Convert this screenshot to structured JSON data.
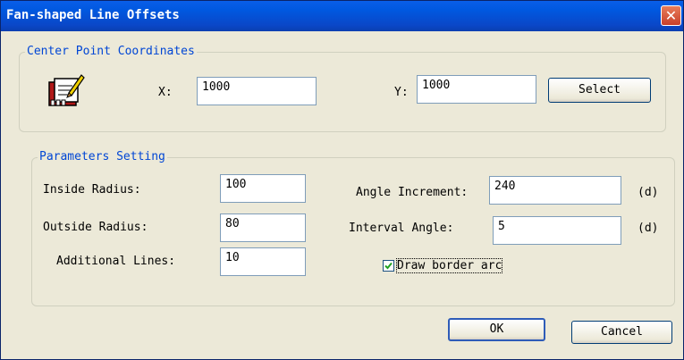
{
  "window": {
    "title": "Fan-shaped Line Offsets"
  },
  "center": {
    "legend": "Center Point Coordinates",
    "x_label": "X:",
    "x_value": "1000",
    "y_label": "Y:",
    "y_value": "1000",
    "select_label": "Select"
  },
  "params": {
    "legend": "Parameters Setting",
    "inside_radius_label": "Inside Radius:",
    "inside_radius_value": "100",
    "outside_radius_label": "Outside Radius:",
    "outside_radius_value": "80",
    "additional_lines_label": "Additional Lines:",
    "additional_lines_value": "10",
    "angle_increment_label": "Angle Increment:",
    "angle_increment_value": "240",
    "angle_increment_unit": "(d)",
    "interval_angle_label": "Interval Angle:",
    "interval_angle_value": "5",
    "interval_angle_unit": "(d)",
    "draw_border_arc_label": "Draw border arc",
    "draw_border_arc_checked": true
  },
  "buttons": {
    "ok": "OK",
    "cancel": "Cancel"
  },
  "icons": {
    "close": "close-icon",
    "edit": "notebook-pencil-icon",
    "check": "checkmark-icon"
  }
}
